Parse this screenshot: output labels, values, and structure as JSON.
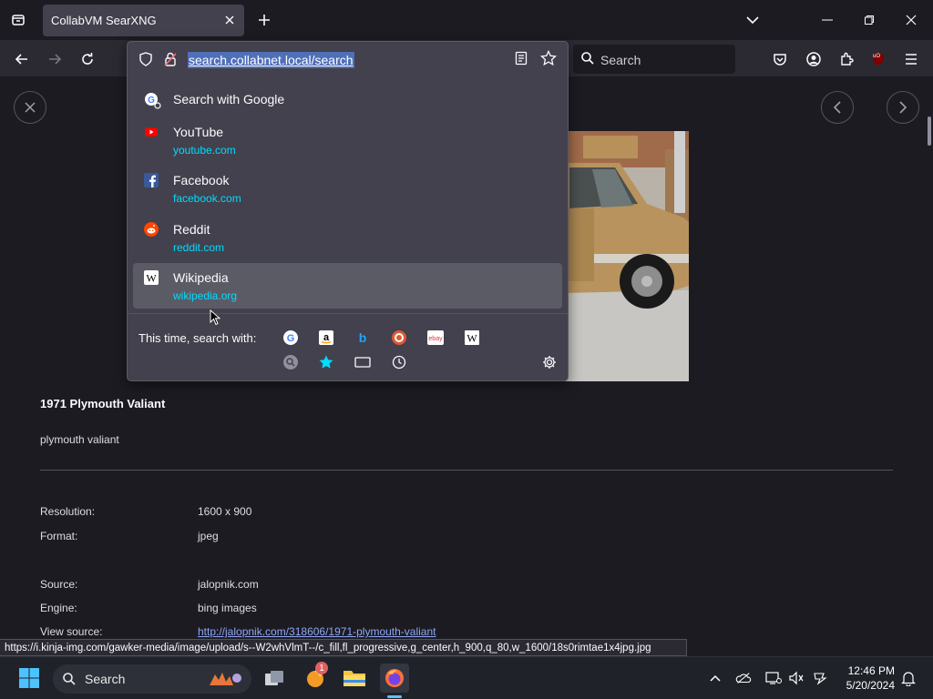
{
  "tabstrip": {
    "active_tab_title": "CollabVM SearXNG"
  },
  "navbar": {
    "web_search_placeholder": "Search",
    "ublock_label": "uO"
  },
  "urlbar": {
    "url": "search.collabnet.local/search",
    "suggestions": [
      {
        "title": "Search with Google",
        "url": "",
        "icon": "google-search-icon"
      },
      {
        "title": "YouTube",
        "url": "youtube.com",
        "icon": "youtube-icon"
      },
      {
        "title": "Facebook",
        "url": "facebook.com",
        "icon": "facebook-icon"
      },
      {
        "title": "Reddit",
        "url": "reddit.com",
        "icon": "reddit-icon"
      },
      {
        "title": "Wikipedia",
        "url": "wikipedia.org",
        "icon": "wikipedia-icon"
      }
    ],
    "oneoff_label": "This time, search with:",
    "engines": [
      "google",
      "amazon",
      "bing",
      "duckduckgo",
      "ebay",
      "wikipedia"
    ],
    "ebay_label": "ebay",
    "wiki_label": "W",
    "amazon_label": "a",
    "bing_label": "b",
    "google_label": "G",
    "modes": [
      "search-mode",
      "bookmarks",
      "tabs",
      "history"
    ]
  },
  "result": {
    "title": "1971 Plymouth Valiant",
    "description": "plymouth valiant",
    "meta": [
      {
        "label": "Resolution:",
        "value": "1600 x 900"
      },
      {
        "label": "Format:",
        "value": "jpeg"
      },
      {
        "label": "Source:",
        "value": "jalopnik.com"
      },
      {
        "label": "Engine:",
        "value": "bing images"
      },
      {
        "label": "View source:",
        "value": "http://jalopnik.com/318606/1971-plymouth-valiant"
      }
    ]
  },
  "statusbar": {
    "text": "https://i.kinja-img.com/gawker-media/image/upload/s--W2whVlmT--/c_fill,fl_progressive,g_center,h_900,q_80,w_1600/18s0rimtae1x4jpg.jpg"
  },
  "taskbar": {
    "search_label": "Search",
    "notification_count": "1",
    "time": "12:46 PM",
    "date": "5/20/2024"
  },
  "colors": {
    "accent_link": "#00ddff",
    "url_highlight": "#4f6fb8",
    "tab_bg": "#42414d",
    "toolbar_bg": "#2b2a33"
  }
}
